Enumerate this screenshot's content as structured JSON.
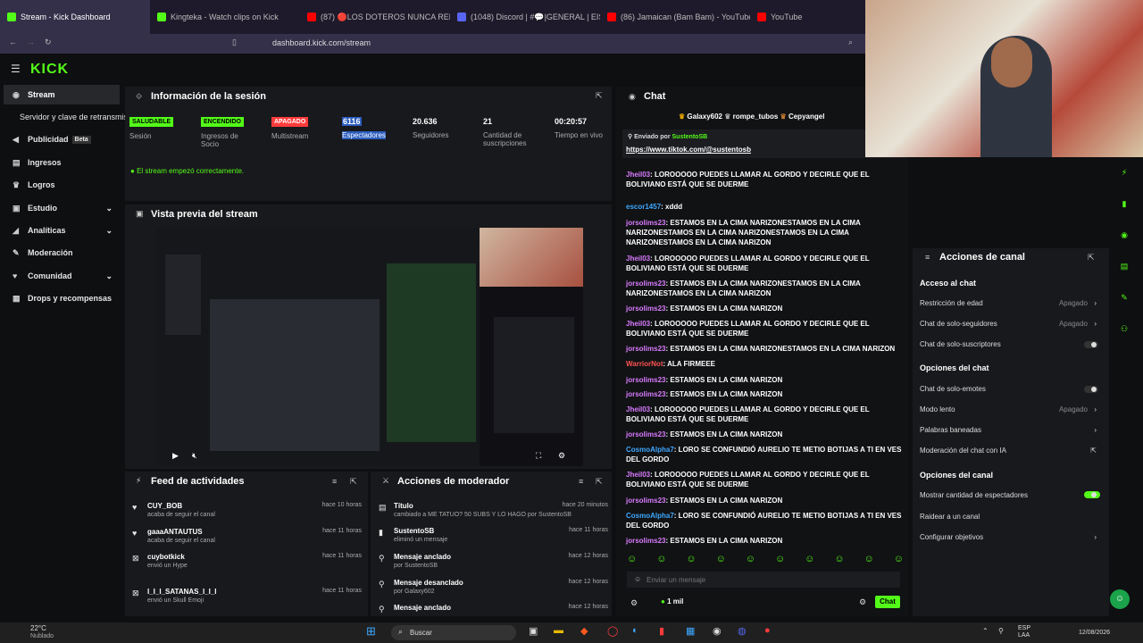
{
  "browser": {
    "tabs": [
      "Stream - Kick Dashboard",
      "Kingteka - Watch clips on Kick",
      "(87) 🔴LOS DOTEROS NUNCA RELIN…",
      "(1048) Discord | #💬|GENERAL | EISUS…",
      "(86) Jamaican (Bam Bam) - YouTube",
      "YouTube"
    ],
    "url": "dashboard.kick.com/stream"
  },
  "logo": "KICK",
  "sidebar": {
    "items": [
      {
        "label": "Stream",
        "icon": "broadcast-icon"
      },
      {
        "label": "Servidor y clave de retransmisión"
      },
      {
        "label": "Publicidad",
        "badge": "Beta",
        "icon": "megaphone-icon"
      },
      {
        "label": "Ingresos",
        "icon": "chart-icon"
      },
      {
        "label": "Logros",
        "icon": "trophy-icon"
      },
      {
        "label": "Estudio",
        "icon": "studio-icon"
      },
      {
        "label": "Analíticas",
        "icon": "analytics-icon"
      },
      {
        "label": "Moderación",
        "icon": "wrench-icon"
      },
      {
        "label": "Comunidad",
        "icon": "community-icon"
      },
      {
        "label": "Drops y recompensas",
        "icon": "gift-icon"
      }
    ]
  },
  "session": {
    "title": "Información de la sesión",
    "stats": [
      {
        "badge": "SALUDABLE",
        "label": "Sesión"
      },
      {
        "badge": "ENCENDIDO",
        "label": "Ingresos de Socio"
      },
      {
        "badge": "APAGADO",
        "label": "Multistream"
      },
      {
        "value": "6116",
        "label": "Espectadores"
      },
      {
        "value": "20.636",
        "label": "Seguidores"
      },
      {
        "value": "21",
        "label": "Cantidad de suscripciones"
      },
      {
        "value": "00:20:57",
        "label": "Tiempo en vivo"
      }
    ],
    "status": "El stream empezó correctamente."
  },
  "preview": {
    "title": "Vista previa del stream"
  },
  "feed": {
    "title": "Feed de actividades",
    "items": [
      {
        "user": "CUY_BOB",
        "sub": "acaba de seguir el canal",
        "time": "hace 10 horas"
      },
      {
        "user": "gaaaANTAUTUS",
        "sub": "acaba de seguir el canal",
        "time": "hace 11 horas"
      },
      {
        "user": "cuybotkick",
        "sub": "envió un Hype",
        "time": "hace 11 horas"
      },
      {
        "user": "I_I_I_SATANAS_I_I_I",
        "sub": "envió un Skull Emoji",
        "time": "hace 11 horas"
      }
    ]
  },
  "mod": {
    "title": "Acciones de moderador",
    "items": [
      {
        "user": "Título",
        "sub": "cambiado a ME TATUO? 50 SUBS Y LO HAGO por SustentoSB",
        "time": "hace 20 minutos"
      },
      {
        "user": "SustentoSB",
        "sub": "eliminó un mensaje",
        "time": "hace 11 horas"
      },
      {
        "user": "Mensaje anclado",
        "sub": "por SustentoSB",
        "time": "hace 12 horas"
      },
      {
        "user": "Mensaje desanclado",
        "sub": "por Galaxy602",
        "time": "hace 12 horas"
      },
      {
        "user": "Mensaje anclado",
        "sub": "",
        "time": "hace 12 horas"
      }
    ]
  },
  "chat": {
    "title": "Chat",
    "top": [
      "Galaxy602",
      "rompe_tubos",
      "Cepyangel"
    ],
    "pinned_by": "Enviado por",
    "pinned_user": "SustentoSB",
    "pinned_link": "https://www.tiktok.com/@sustentosb",
    "messages": [
      {
        "u": "Jheil03",
        "t": ": LOROOOOO PUEDES LLAMAR AL GORDO Y DECIRLE QUE EL BOLIVIANO ESTÁ QUE SE DUERME"
      },
      {
        "u": "escor1457",
        "t": ": xddd"
      },
      {
        "u": "jorsolims23",
        "t": ": ESTAMOS EN LA CIMA NARIZONESTAMOS EN LA CIMA NARIZONESTAMOS EN LA CIMA NARIZONESTAMOS EN LA CIMA NARIZONESTAMOS EN LA CIMA NARIZON"
      },
      {
        "u": "Jheil03",
        "t": ": LOROOOOO PUEDES LLAMAR AL GORDO Y DECIRLE QUE EL BOLIVIANO ESTÁ QUE SE DUERME"
      },
      {
        "u": "jorsolims23",
        "t": ": ESTAMOS EN LA CIMA NARIZONESTAMOS EN LA CIMA NARIZONESTAMOS EN LA CIMA NARIZON"
      },
      {
        "u": "jorsolims23",
        "t": ": ESTAMOS EN LA CIMA NARIZON"
      },
      {
        "u": "Jheil03",
        "t": ": LOROOOOO PUEDES LLAMAR AL GORDO Y DECIRLE QUE EL BOLIVIANO ESTÁ QUE SE DUERME"
      },
      {
        "u": "jorsolims23",
        "t": ": ESTAMOS EN LA CIMA NARIZONESTAMOS EN LA CIMA NARIZON"
      },
      {
        "u": "WarriorNot",
        "t": ": ALA FIRMEEE"
      },
      {
        "u": "jorsolims23",
        "t": ": ESTAMOS EN LA CIMA NARIZON"
      },
      {
        "u": "jorsolims23",
        "t": ": ESTAMOS EN LA CIMA NARIZON"
      },
      {
        "u": "Jheil03",
        "t": ": LOROOOOO PUEDES LLAMAR AL GORDO Y DECIRLE QUE EL BOLIVIANO ESTÁ QUE SE DUERME"
      },
      {
        "u": "jorsolims23",
        "t": ": ESTAMOS EN LA CIMA NARIZON"
      },
      {
        "u": "CosmoAlpha7",
        "t": ": LORO SE CONFUNDIÓ AURELIO TE METIO BOTIJAS A TI EN VES DEL GORDO"
      },
      {
        "u": "Jheil03",
        "t": ": LOROOOOO PUEDES LLAMAR AL GORDO Y DECIRLE QUE EL BOLIVIANO ESTÁ QUE SE DUERME"
      },
      {
        "u": "jorsolims23",
        "t": ": ESTAMOS EN LA CIMA NARIZON"
      },
      {
        "u": "CosmoAlpha7",
        "t": ": LORO SE CONFUNDIÓ AURELIO TE METIO BOTIJAS A TI EN VES DEL GORDO"
      },
      {
        "u": "jorsolims23",
        "t": ": ESTAMOS EN LA CIMA NARIZON"
      }
    ],
    "placeholder": "Enviar un mensaje",
    "count": "1 mil",
    "send": "Chat"
  },
  "actions": {
    "title": "Acciones de canal",
    "sections": [
      {
        "h": "Acceso al chat",
        "items": [
          {
            "l": "Restricción de edad",
            "v": "Apagado"
          },
          {
            "l": "Chat de solo-seguidores",
            "v": "Apagado"
          },
          {
            "l": "Chat de solo-suscriptores",
            "toggle": false
          }
        ]
      },
      {
        "h": "Opciones del chat",
        "items": [
          {
            "l": "Chat de solo-emotes",
            "toggle": false
          },
          {
            "l": "Modo lento",
            "v": "Apagado"
          },
          {
            "l": "Palabras baneadas"
          },
          {
            "l": "Moderación del chat con IA"
          }
        ]
      },
      {
        "h": "Opciones del canal",
        "items": [
          {
            "l": "Mostrar cantidad de espectadores",
            "toggle": true
          },
          {
            "l": "Raidear a un canal"
          },
          {
            "l": "Configurar objetivos"
          }
        ]
      }
    ]
  },
  "taskbar": {
    "temp": "22°C",
    "weather": "Nublado",
    "search": "Buscar",
    "lang": "ESP\nLAA",
    "date": "12/08/2026"
  }
}
